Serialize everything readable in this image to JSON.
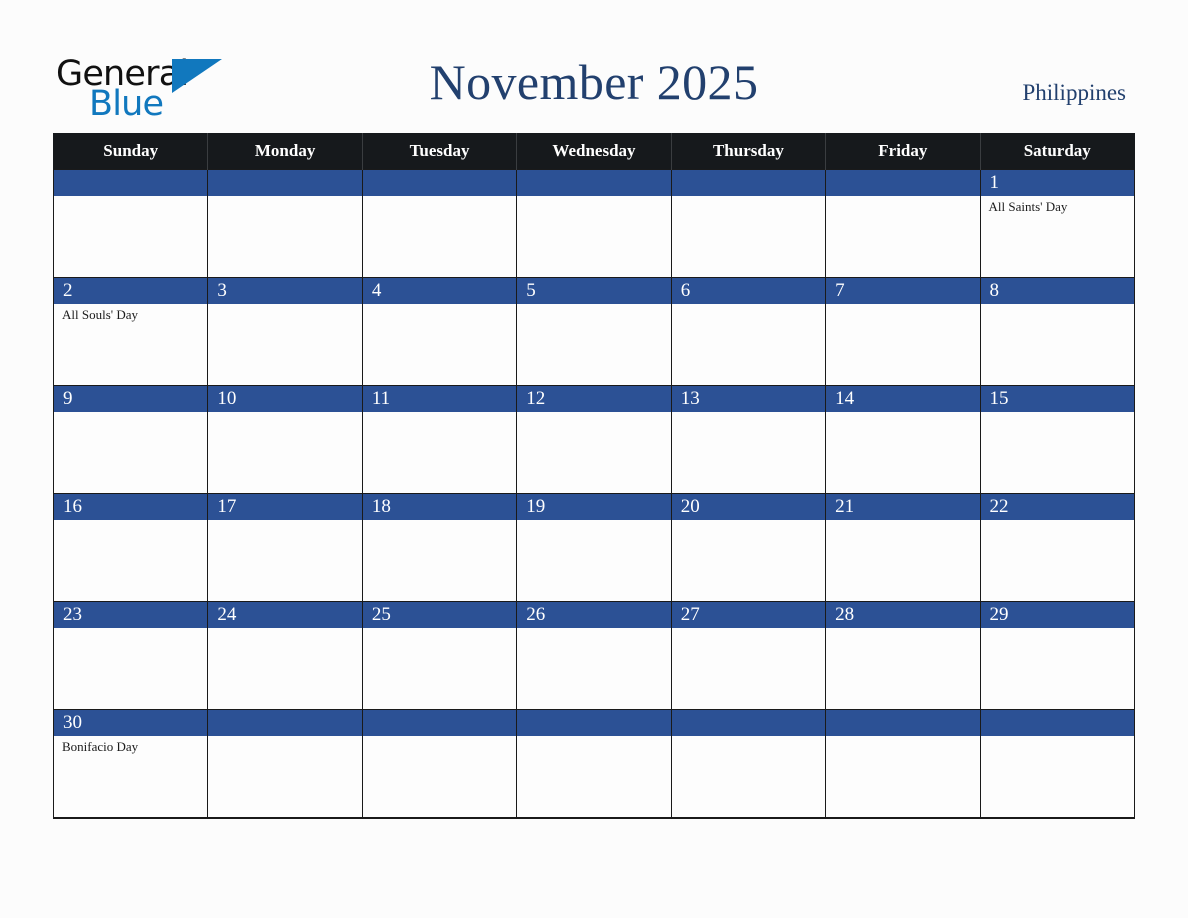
{
  "brand": {
    "word_one": "General",
    "word_two": "Blue",
    "triangle_icon": "triangle-icon",
    "color_black": "#111111",
    "color_blue": "#1178be"
  },
  "header": {
    "title": "November 2025",
    "country": "Philippines",
    "title_color": "#22406e"
  },
  "calendar": {
    "weekday_headers": [
      "Sunday",
      "Monday",
      "Tuesday",
      "Wednesday",
      "Thursday",
      "Friday",
      "Saturday"
    ],
    "header_bg": "#16191c",
    "daybar_bg": "#2c5195",
    "grid_line": "#1a1a1a",
    "weeks": [
      [
        {
          "day": "",
          "events": []
        },
        {
          "day": "",
          "events": []
        },
        {
          "day": "",
          "events": []
        },
        {
          "day": "",
          "events": []
        },
        {
          "day": "",
          "events": []
        },
        {
          "day": "",
          "events": []
        },
        {
          "day": "1",
          "events": [
            "All Saints' Day"
          ]
        }
      ],
      [
        {
          "day": "2",
          "events": [
            "All Souls' Day"
          ]
        },
        {
          "day": "3",
          "events": []
        },
        {
          "day": "4",
          "events": []
        },
        {
          "day": "5",
          "events": []
        },
        {
          "day": "6",
          "events": []
        },
        {
          "day": "7",
          "events": []
        },
        {
          "day": "8",
          "events": []
        }
      ],
      [
        {
          "day": "9",
          "events": []
        },
        {
          "day": "10",
          "events": []
        },
        {
          "day": "11",
          "events": []
        },
        {
          "day": "12",
          "events": []
        },
        {
          "day": "13",
          "events": []
        },
        {
          "day": "14",
          "events": []
        },
        {
          "day": "15",
          "events": []
        }
      ],
      [
        {
          "day": "16",
          "events": []
        },
        {
          "day": "17",
          "events": []
        },
        {
          "day": "18",
          "events": []
        },
        {
          "day": "19",
          "events": []
        },
        {
          "day": "20",
          "events": []
        },
        {
          "day": "21",
          "events": []
        },
        {
          "day": "22",
          "events": []
        }
      ],
      [
        {
          "day": "23",
          "events": []
        },
        {
          "day": "24",
          "events": []
        },
        {
          "day": "25",
          "events": []
        },
        {
          "day": "26",
          "events": []
        },
        {
          "day": "27",
          "events": []
        },
        {
          "day": "28",
          "events": []
        },
        {
          "day": "29",
          "events": []
        }
      ],
      [
        {
          "day": "30",
          "events": [
            "Bonifacio Day"
          ]
        },
        {
          "day": "",
          "events": []
        },
        {
          "day": "",
          "events": []
        },
        {
          "day": "",
          "events": []
        },
        {
          "day": "",
          "events": []
        },
        {
          "day": "",
          "events": []
        },
        {
          "day": "",
          "events": []
        }
      ]
    ]
  }
}
